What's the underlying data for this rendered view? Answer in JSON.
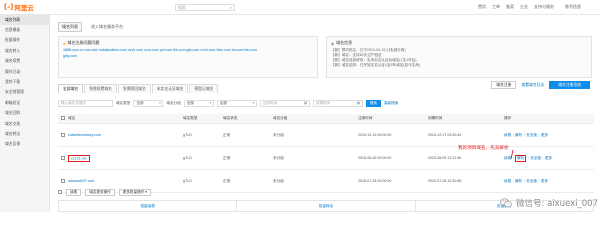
{
  "brand": {
    "mark": "[-]",
    "name": "阿里云"
  },
  "header": {
    "search_placeholder": "搜索",
    "nav": [
      "费用",
      "工单",
      "备案",
      "企业",
      "支持与服务"
    ],
    "account": "账号信息"
  },
  "sidebar": {
    "items": [
      "域名列表",
      "信息模板",
      "批量操作",
      "域名转入",
      "域名续费",
      "操作记录",
      "我的下载",
      "安全锁管理",
      "邮箱验证",
      "域名回购",
      "域名交易",
      "域名转出",
      "域名反馈"
    ],
    "active_index": 0
  },
  "page_tabs": {
    "items": [
      "域名列表",
      "进入域名服务平台"
    ],
    "active_index": 0
  },
  "notice_left": {
    "title": "域名注册问题问题",
    "lines": [
      "1688.com.cn  nnn.com  wdsktoolbox.com  vvvh.com  vvvv.com  pcl.com  fkk.com  gfa.com  vvvh.com  fzdx.com  tsr.com  lsb.com",
      "gdq.com"
    ]
  },
  "notice_right": {
    "title": "域名信息",
    "lines": [
      "【新】预约抢注：已于2019-03-15上线(部分首)",
      "【新】域名：支持60天过户验证",
      "【新】域名信息修改：支持实名认证后域名(1至1年后)",
      "【新】域名结构：已开放实名认证1至5年域名(如今生命)"
    ]
  },
  "status_tabs": [
    "全部域名",
    "急需续费域名",
    "急需赎回域名",
    "未实名认证域名",
    "预登记域名"
  ],
  "actions": {
    "link1": "域名注册",
    "link2": "查看域名日志",
    "add_button": "域名注册添加"
  },
  "filters": {
    "search_placeholder": "输入域名关键字",
    "type_label": "域名类型",
    "type_value": "全部",
    "group_label": "域名分组",
    "group_value": "全部",
    "status_value": "全部",
    "reg_date_placeholder": "注册时间",
    "exp_date_placeholder": "到期时间",
    "search_button": "搜索",
    "advanced": "高级搜索"
  },
  "table": {
    "headers": [
      "域名",
      "域名类型",
      "域名状态",
      "域名分组",
      "注册时间",
      "到期时间",
      "",
      "操作"
    ],
    "rows": [
      {
        "domain": "zuiweidomainsy.com",
        "type": "gTLD",
        "status": "正常",
        "group": "未分组",
        "reg": "2019-12-15 00:00:00",
        "exp": "2024-12-17 03:30:44"
      },
      {
        "domain": "cc121.net",
        "type": "gTLD",
        "status": "正常",
        "group": "未分组",
        "reg": "2015-06-06 00:00:00",
        "exp": "2023-06-09 11:21:36"
      },
      {
        "domain": "aihaomi007.com",
        "type": "gTLD",
        "status": "正常",
        "group": "未分组",
        "reg": "2016-07-28 00:00:00",
        "exp": "2022-07-28 12:30:56"
      }
    ],
    "ops": [
      "续费",
      "解析",
      "安全锁",
      "更多"
    ],
    "highlight_row": 1
  },
  "annotation": "我的项目域名，先去解析",
  "bulk": {
    "button1": "续费",
    "button2": "域名更多操作",
    "button3": "更多批量操作"
  },
  "bottom_tabs": [
    "批量续费",
    "批量转出",
    "批量解析"
  ],
  "watermark": "微信号: aixuexi_007"
}
